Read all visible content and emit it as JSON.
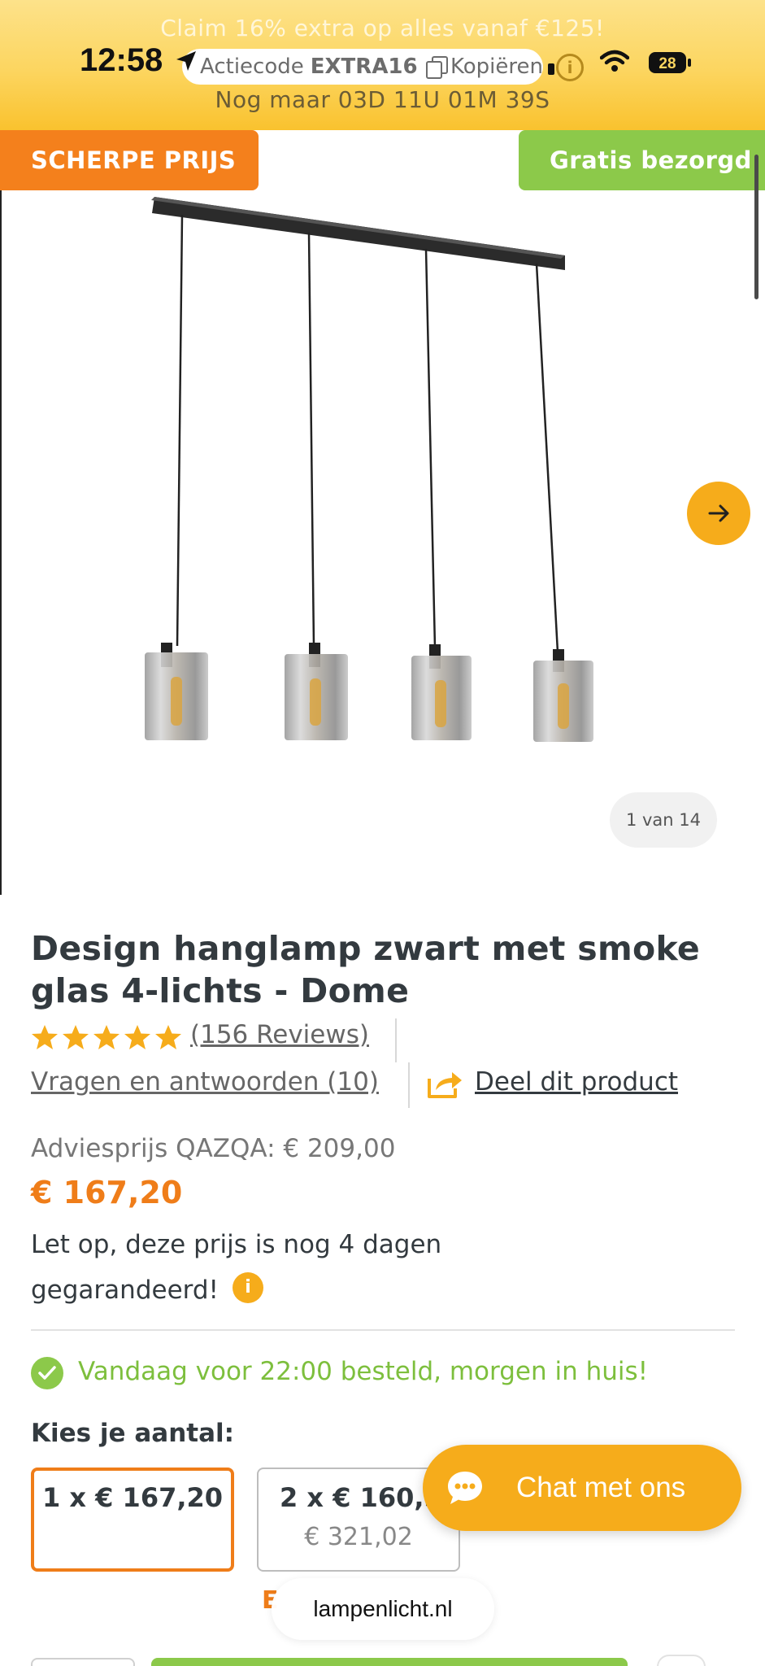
{
  "status_bar": {
    "time": "12:58",
    "battery": "28"
  },
  "promo": {
    "headline": "Claim 16% extra op alles vanaf €125!",
    "code_prefix": "Actiecode",
    "code": "EXTRA16",
    "copy_label": "Kopiëren",
    "countdown": "Nog maar 03D 11U 01M 39S"
  },
  "badges": {
    "left": "SCHERPE PRIJS",
    "right": "Gratis bezorgd"
  },
  "gallery": {
    "counter": "1 van 14"
  },
  "product": {
    "title": "Design hanglamp zwart met smoke glas 4-lichts - Dome",
    "rating_stars": 5,
    "reviews_link": "(156 Reviews)",
    "qa_link": "Vragen en antwoorden (10)",
    "share_link": "Deel dit product",
    "msrp": "Adviesprijs QAZQA:  € 209,00",
    "price": "€ 167,20",
    "guarantee": "Let op, deze prijs is nog 4 dagen gegarandeerd!",
    "delivery": "Vandaag voor 22:00 besteld, morgen in huis!"
  },
  "quantity": {
    "label": "Kies je aantal:",
    "options": [
      {
        "line1": "1 x € 167,20",
        "line2": ""
      },
      {
        "line1": "2 x € 160,5",
        "line2": "€ 321,02"
      }
    ],
    "partial_next": "E"
  },
  "chat": {
    "label": "Chat met ons"
  },
  "browser": {
    "url": "lampenlicht.nl"
  },
  "colors": {
    "accent_orange": "#ef7d19",
    "accent_yellow": "#f6ac1b",
    "accent_green": "#8cc94a"
  }
}
